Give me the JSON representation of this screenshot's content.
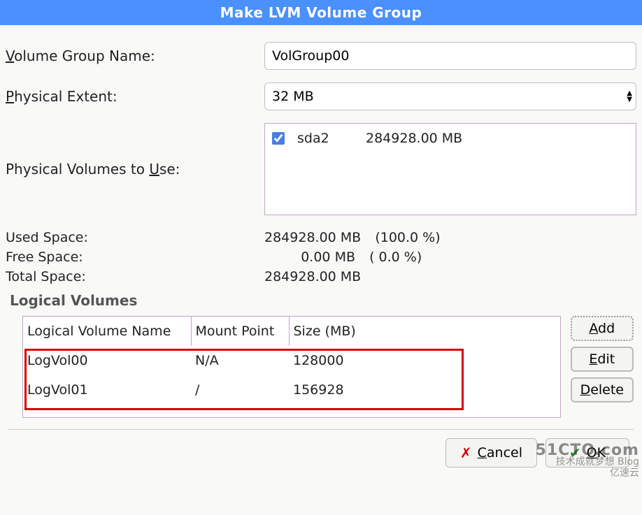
{
  "dialog": {
    "title": "Make LVM Volume Group"
  },
  "labels": {
    "vg_name_pre": "V",
    "vg_name_post": "olume Group Name:",
    "pe_pre": "P",
    "pe_post": "hysical Extent:",
    "pv_use_pre": "Physical Volumes to ",
    "pv_use_u": "U",
    "pv_use_post": "se:",
    "used_space": "Used Space:",
    "free_space": "Free Space:",
    "total_space": "Total Space:",
    "logical_volumes": "Logical Volumes"
  },
  "vg_name_value": "VolGroup00",
  "physical_extent_value": "32 MB",
  "pv_items": [
    {
      "checked": true,
      "name": "sda2",
      "size": "284928.00 MB"
    }
  ],
  "space": {
    "used_val": "284928.00 MB",
    "used_pct": "(100.0 %)",
    "free_val": "0.00 MB",
    "free_pct": "( 0.0 %)",
    "total_val": "284928.00 MB"
  },
  "lv_table": {
    "headers": {
      "name": "Logical Volume Name",
      "mount": "Mount Point",
      "size": "Size (MB)"
    },
    "rows": [
      {
        "name": "LogVol00",
        "mount": "N/A",
        "size": "128000"
      },
      {
        "name": "LogVol01",
        "mount": "/",
        "size": "156928"
      }
    ]
  },
  "buttons": {
    "add_u": "A",
    "add_post": "dd",
    "edit_u": "E",
    "edit_post": "dit",
    "delete_u": "D",
    "delete_post": "elete",
    "cancel_u": "C",
    "cancel_post": "ancel",
    "ok_u": "O",
    "ok_post": "K"
  },
  "watermark": {
    "line1": "51CTO.com",
    "line2": "技术成就梦想 Blog",
    "line3": "亿速云"
  }
}
